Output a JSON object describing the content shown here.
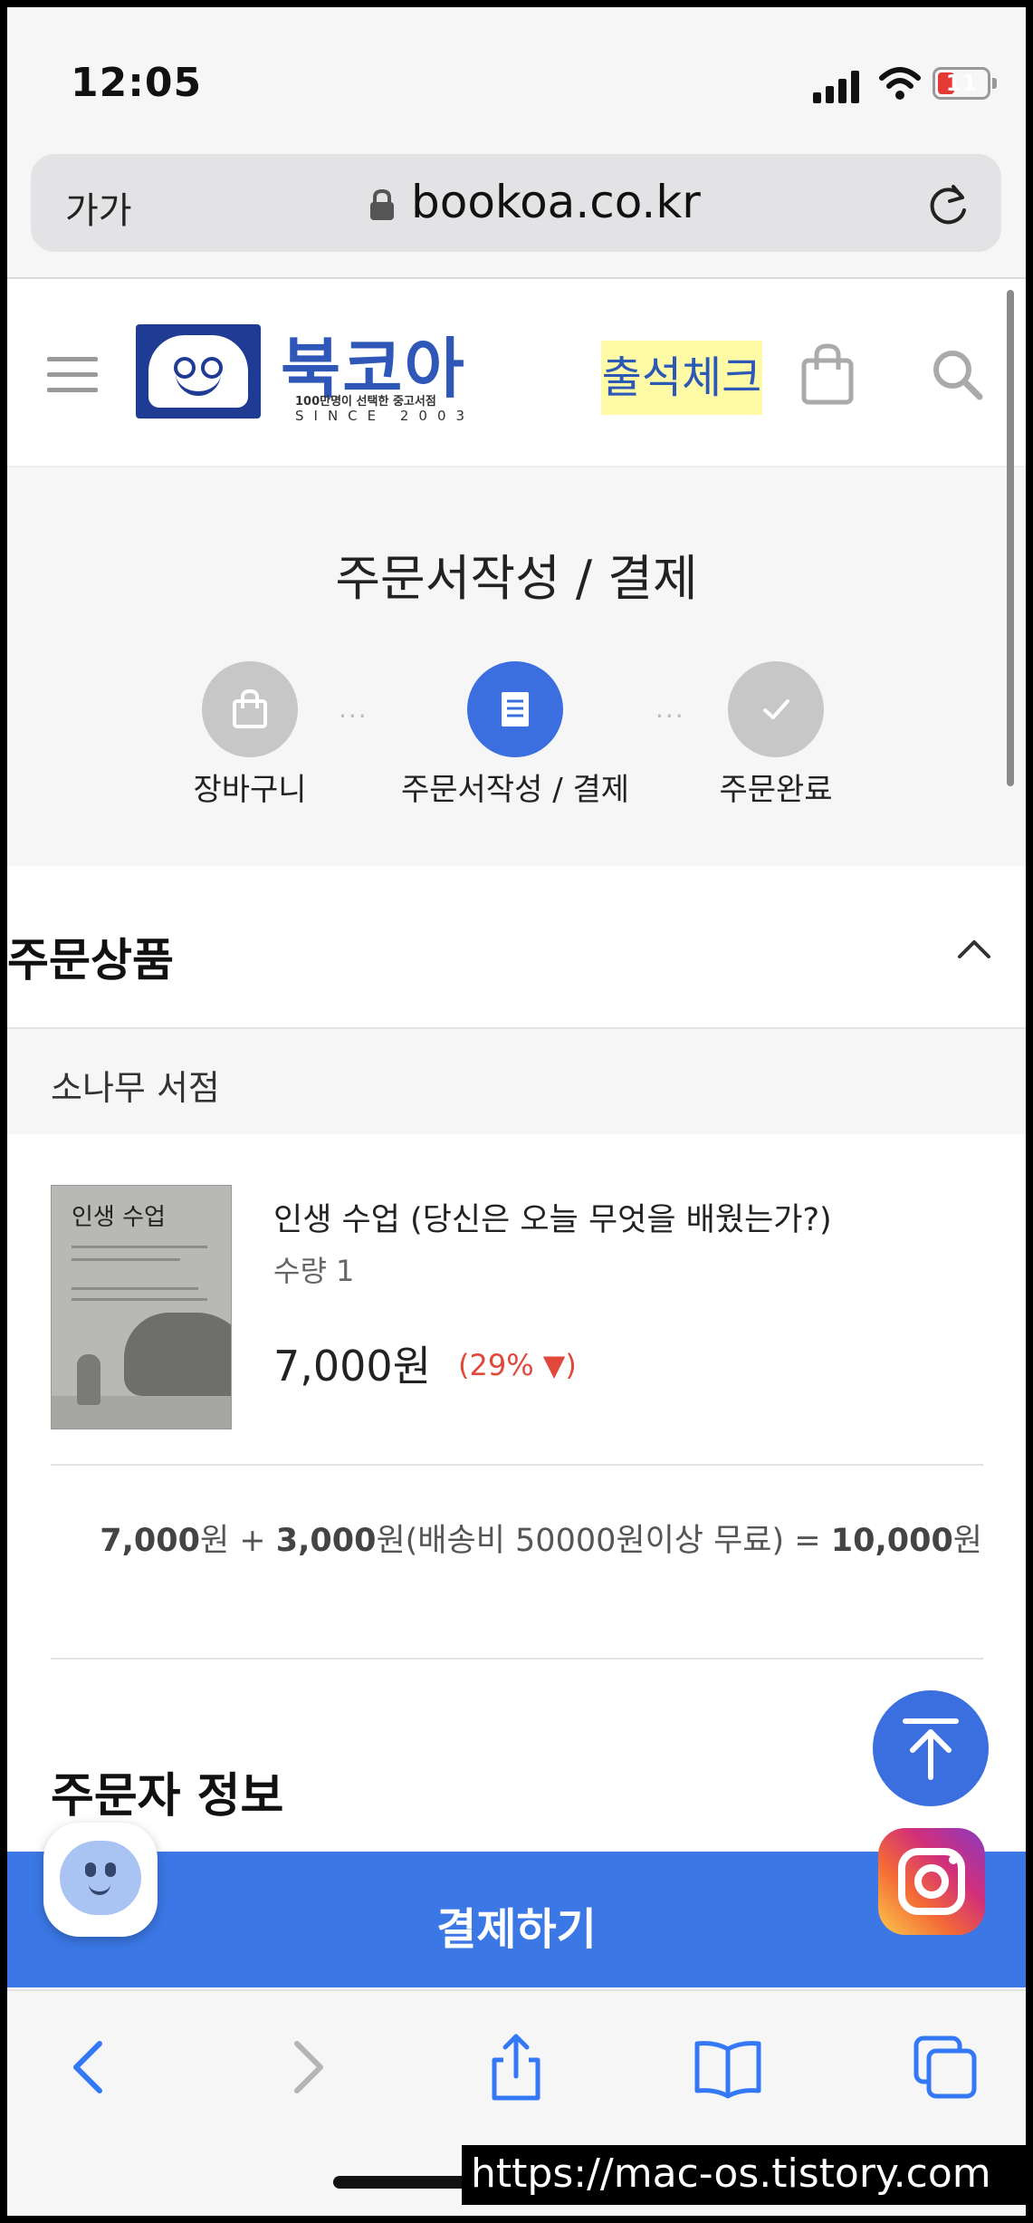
{
  "status_bar": {
    "time": "12:05",
    "battery": "11"
  },
  "browser": {
    "text_size_label": "가가",
    "url": "bookoa.co.kr"
  },
  "site_header": {
    "logo_name": "북코아",
    "logo_tagline": "100만명이 선택한 중고서점",
    "logo_since": "SINCE 2003",
    "checkin_label": "출석체크"
  },
  "checkout": {
    "page_title": "주문서작성 / 결제",
    "steps": [
      {
        "label": "장바구니",
        "icon": "shopping-bag-icon",
        "active": false
      },
      {
        "label": "주문서작성 / 결제",
        "icon": "receipt-icon",
        "active": true
      },
      {
        "label": "주문완료",
        "icon": "checkmark-icon",
        "active": false
      }
    ],
    "step_separator": "···"
  },
  "order_products": {
    "section_title": "주문상품",
    "store_name": "소나무 서점",
    "product": {
      "cover_title": "인생 수업",
      "title": "인생 수업 (당신은 오늘 무엇을 배웠는가?)",
      "quantity": "수량 1",
      "price": "7,000원",
      "discount": "(29% ▼)"
    },
    "summary": {
      "items_amount": "7,000",
      "won1": "원 + ",
      "shipping_amount": "3,000",
      "shipping_note": "원(배송비 50000원이상 무료) = ",
      "total_amount": "10,000",
      "won2": "원"
    }
  },
  "orderer": {
    "section_title": "주문자 정보"
  },
  "pay_button": {
    "label": "결제하기"
  },
  "watermark": "https://mac-os.tistory.com",
  "colors": {
    "accent": "#3b78e6",
    "discount": "#e0483a",
    "checkin_bg": "#fffaa6"
  }
}
